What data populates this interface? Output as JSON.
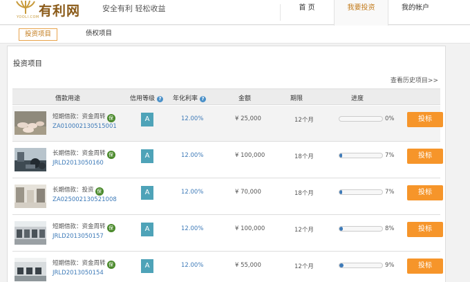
{
  "brand": {
    "name": "有利网",
    "sub": "YOOLI.COM",
    "slogan": "安全有利  轻松收益"
  },
  "nav": {
    "home": "首  页",
    "invest": "我要投资",
    "account": "我的帐户"
  },
  "subtabs": {
    "invest": "投资项目",
    "debt": "债权项目"
  },
  "panel": {
    "title": "投资项目",
    "history": "查看历史项目>>"
  },
  "table": {
    "headers": {
      "purpose": "借款用途",
      "grade": "信用等级",
      "rate": "年化利率",
      "amount": "金额",
      "term": "期限",
      "progress": "进度"
    },
    "help_icon": "?",
    "rows": [
      {
        "purpose": "短期借款：资金周转",
        "badge": "保",
        "code": "ZA010002130515001",
        "grade": "A",
        "rate": "12.00%",
        "amount": "¥ 25,000",
        "term": "12个月",
        "progress": 0,
        "progress_label": "0%",
        "action": "投标"
      },
      {
        "purpose": "长期借款：资金周转",
        "badge": "保",
        "code": "JRLD2013050160",
        "grade": "A",
        "rate": "12.00%",
        "amount": "¥ 100,000",
        "term": "18个月",
        "progress": 7,
        "progress_label": "7%",
        "action": "投标"
      },
      {
        "purpose": "长期借款：投资",
        "badge": "保",
        "code": "ZA025002130521008",
        "grade": "A",
        "rate": "12.00%",
        "amount": "¥ 70,000",
        "term": "18个月",
        "progress": 7,
        "progress_label": "7%",
        "action": "投标"
      },
      {
        "purpose": "短期借款：资金周转",
        "badge": "保",
        "code": "JRLD2013050157",
        "grade": "A",
        "rate": "12.00%",
        "amount": "¥ 100,000",
        "term": "12个月",
        "progress": 8,
        "progress_label": "8%",
        "action": "投标"
      },
      {
        "purpose": "短期借款：资金周转",
        "badge": "保",
        "code": "JRLD2013050154",
        "grade": "A",
        "rate": "12.00%",
        "amount": "¥ 55,000",
        "term": "12个月",
        "progress": 9,
        "progress_label": "9%",
        "action": "投标"
      }
    ]
  },
  "colors": {
    "accent": "#f6952a",
    "link": "#3d7ab8",
    "grade": "#4ea3b8",
    "badge": "#4b8a2c"
  }
}
